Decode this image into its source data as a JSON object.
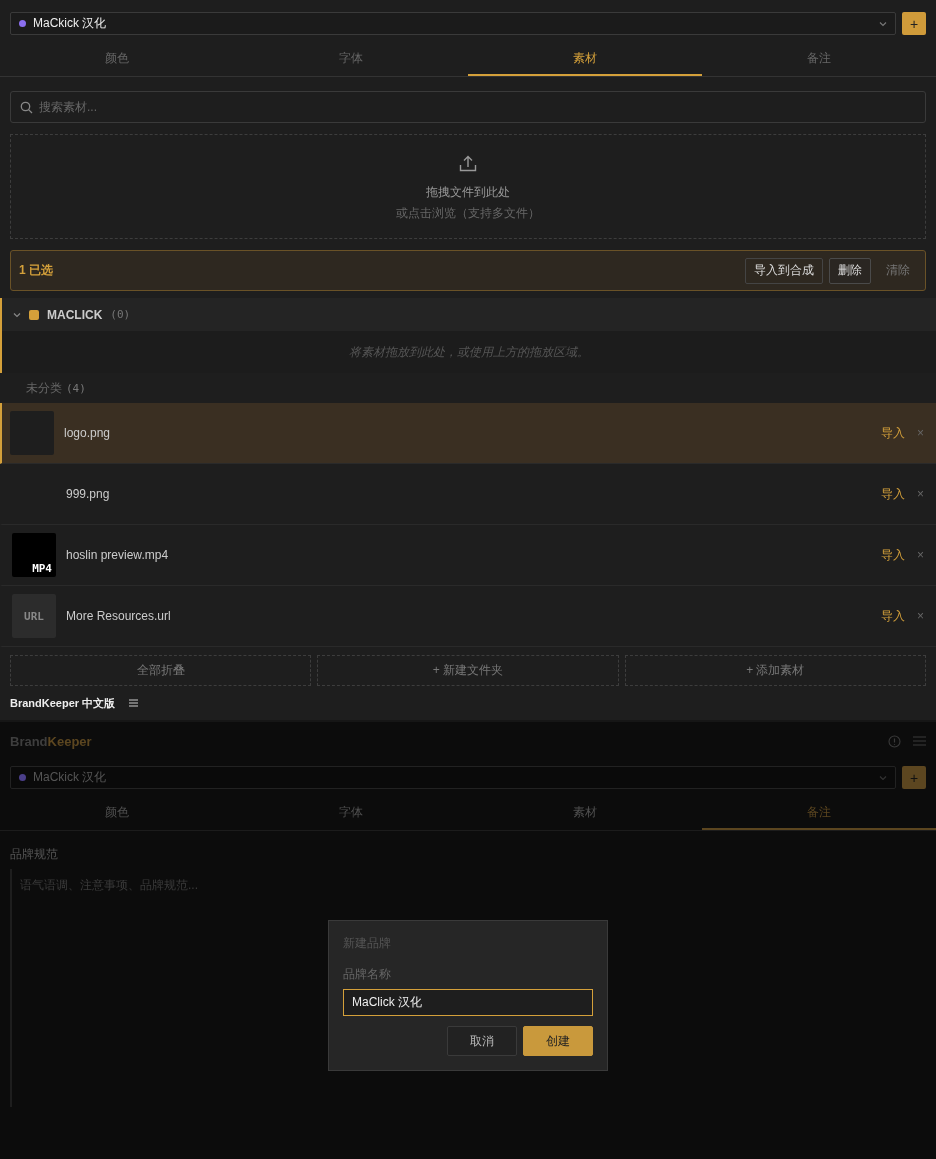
{
  "brand_select": {
    "value": "MaCkick 汉化",
    "color": "#8b6ff0"
  },
  "add_brand_button": "+",
  "tabs": [
    {
      "label": "颜色",
      "selected": false
    },
    {
      "label": "字体",
      "selected": false
    },
    {
      "label": "素材",
      "selected": true
    },
    {
      "label": "备注",
      "selected": false
    }
  ],
  "search": {
    "placeholder": "搜索素材..."
  },
  "dropzone": {
    "title": "拖拽文件到此处",
    "subtitle": "或点击浏览（支持多文件）"
  },
  "selection_bar": {
    "count": "1 已选",
    "buttons": [
      {
        "label": "导入到合成",
        "kind": "outlined"
      },
      {
        "label": "删除",
        "kind": "danger"
      },
      {
        "label": "清除",
        "kind": "plain"
      }
    ]
  },
  "folders": [
    {
      "name": "MACLICK",
      "count": "(0)",
      "color": "#d4a03a",
      "expanded": true,
      "empty_hint": "将素材拖放到此处，或使用上方的拖放区域。"
    }
  ],
  "uncategorized": {
    "label": "未分类",
    "count": "(4)"
  },
  "files": [
    {
      "name": "logo.png",
      "kind": "image",
      "selected": true,
      "action": "导入",
      "remove": "×"
    },
    {
      "name": "999.png",
      "kind": "blank",
      "selected": false,
      "action": "导入",
      "remove": "×"
    },
    {
      "name": "hoslin preview.mp4",
      "kind": "video",
      "thumb_label": "MP4",
      "selected": false,
      "action": "导入",
      "remove": "×"
    },
    {
      "name": "More Resources.url",
      "kind": "url",
      "thumb_label": "URL",
      "selected": false,
      "action": "导入",
      "remove": "×"
    }
  ],
  "footer_buttons": [
    "全部折叠",
    "+ 新建文件夹",
    "+ 添加素材"
  ],
  "panel_tab": {
    "title": "BrandKeeper 中文版"
  },
  "background_app": {
    "logo": [
      "Brand",
      "Keeper"
    ],
    "brand_select": {
      "value": "MaCkick 汉化",
      "color": "#4b3f8a"
    },
    "add_brand_button": "+",
    "tabs": [
      {
        "label": "颜色",
        "selected": false
      },
      {
        "label": "字体",
        "selected": false
      },
      {
        "label": "素材",
        "selected": false
      },
      {
        "label": "备注",
        "selected": true
      }
    ],
    "notes_label": "品牌规范",
    "notes_placeholder": "语气语调、注意事项、品牌规范..."
  },
  "dialog": {
    "title": "新建品牌",
    "field_label": "品牌名称",
    "field_value": "MaClick 汉化",
    "buttons": [
      {
        "label": "取消",
        "kind": "secondary"
      },
      {
        "label": "创建",
        "kind": "primary"
      }
    ]
  }
}
